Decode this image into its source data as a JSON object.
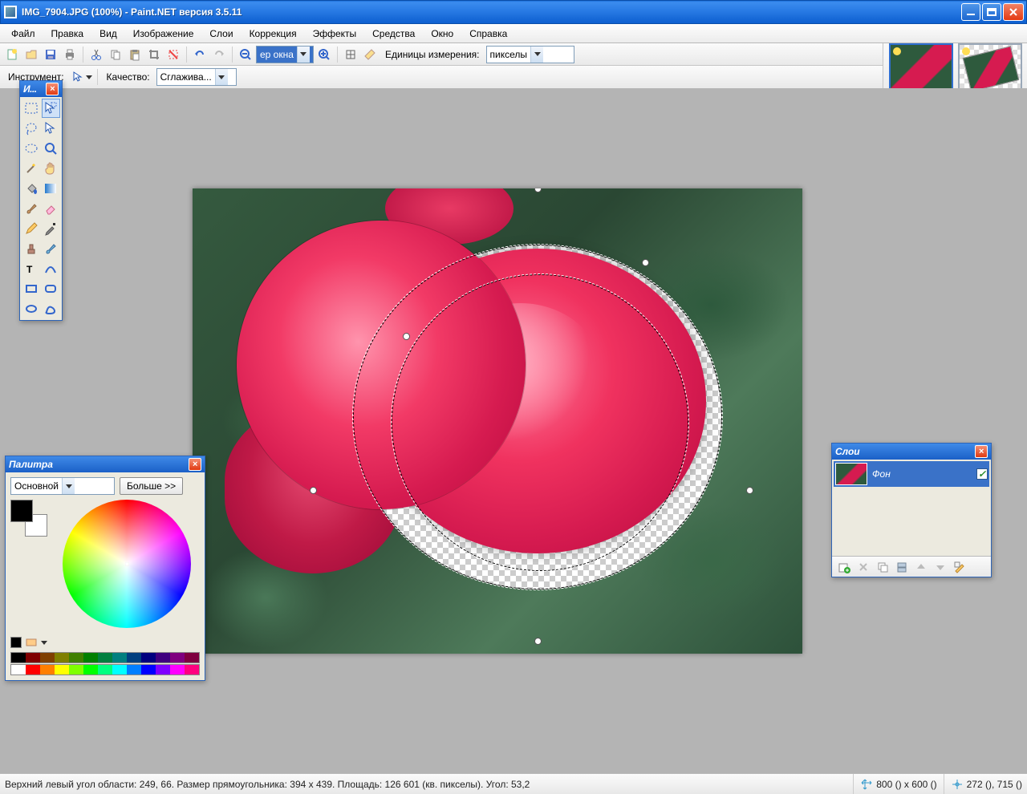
{
  "title": "IMG_7904.JPG (100%) - Paint.NET версия 3.5.11",
  "menu": [
    "Файл",
    "Правка",
    "Вид",
    "Изображение",
    "Слои",
    "Коррекция",
    "Эффекты",
    "Средства",
    "Окно",
    "Справка"
  ],
  "tb1": {
    "zoom_combo": "ер окна",
    "units_label": "Единицы измерения:",
    "units_value": "пикселы"
  },
  "tb2": {
    "tool_label": "Инструмент:",
    "quality_label": "Качество:",
    "quality_value": "Сглажива..."
  },
  "tools_panel": {
    "title": "И..."
  },
  "palette_panel": {
    "title": "Палитра",
    "mode": "Основной",
    "more": "Больше >>"
  },
  "layers_panel": {
    "title": "Слои",
    "layer_name": "Фон"
  },
  "status": {
    "main": "Верхний левый угол области: 249, 66. Размер прямоугольника: 394 x 439. Площадь: 126 601 (кв. пикселы). Угол: 53,2",
    "dims": "800 () x 600 ()",
    "cursor": "272 (), 715 ()"
  },
  "swatches": [
    "#000",
    "#7f0000",
    "#7f3f00",
    "#7f7f00",
    "#3f7f00",
    "#007f00",
    "#007f3f",
    "#007f7f",
    "#003f7f",
    "#00007f",
    "#3f007f",
    "#7f007f",
    "#7f003f",
    "#fff",
    "#f00",
    "#ff7f00",
    "#ff0",
    "#7fff00",
    "#0f0",
    "#00ff7f",
    "#0ff",
    "#007fff",
    "#00f",
    "#7f00ff",
    "#f0f",
    "#ff007f"
  ]
}
